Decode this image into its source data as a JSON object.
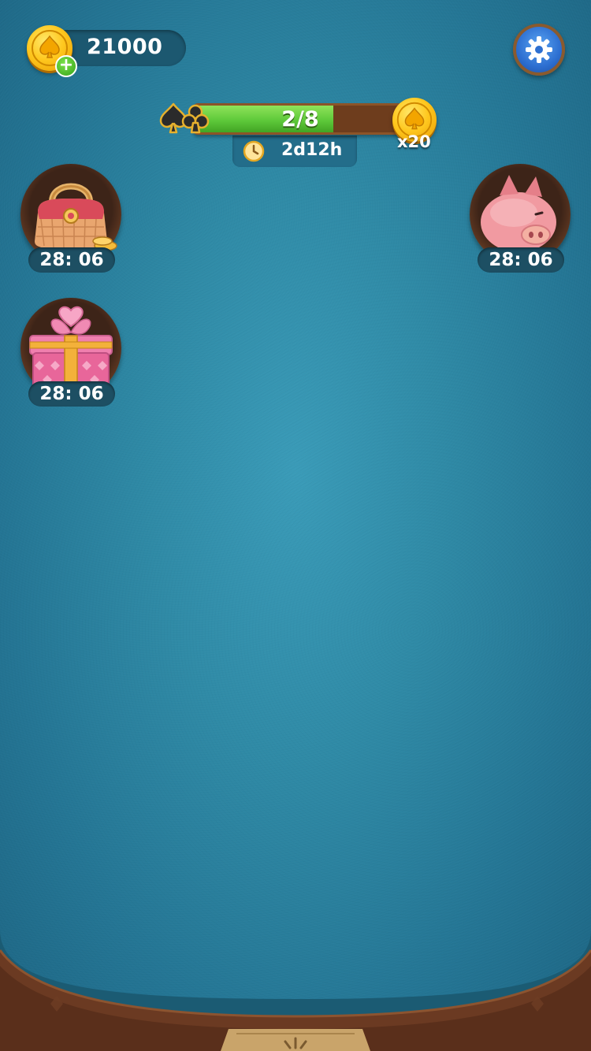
{
  "coins": {
    "balance": "21000",
    "add_symbol": "+"
  },
  "progress": {
    "label": "2/8",
    "current": 2,
    "total": 8,
    "reward_multiplier": "x20",
    "time_left": "2d12h"
  },
  "events": [
    {
      "name": "handbag",
      "timer": "28: 06"
    },
    {
      "name": "piggy-bank",
      "timer": "28: 06"
    },
    {
      "name": "gift-box",
      "timer": "28: 06"
    }
  ],
  "colors": {
    "felt": "#2f8aa6",
    "coin": "#ffc81f",
    "progress_fill": "#5ec93a",
    "progress_track": "#6e3d1d",
    "settings": "#2d6fd1",
    "wood": "#8a5430"
  },
  "icons": [
    "coin-icon",
    "plus-icon",
    "gear-icon",
    "spade-icon",
    "club-icon",
    "clock-icon",
    "handbag-icon",
    "piggy-bank-icon",
    "gift-box-icon"
  ]
}
